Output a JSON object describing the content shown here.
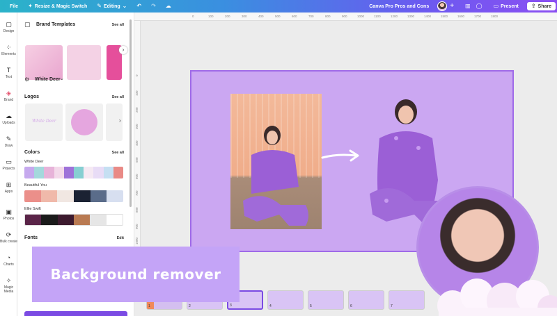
{
  "topbar": {
    "file": "File",
    "resize": "Resize & Magic Switch",
    "editing": "Editing",
    "doc_title": "Canva Pro Pros and Cons",
    "present": "Present",
    "share": "Share"
  },
  "rail": [
    {
      "label": "Design",
      "icon": "design-icon"
    },
    {
      "label": "Elements",
      "icon": "elements-icon"
    },
    {
      "label": "Text",
      "icon": "text-icon"
    },
    {
      "label": "Brand",
      "icon": "brand-icon"
    },
    {
      "label": "Uploads",
      "icon": "uploads-icon"
    },
    {
      "label": "Draw",
      "icon": "draw-icon"
    },
    {
      "label": "Projects",
      "icon": "projects-icon"
    },
    {
      "label": "Apps",
      "icon": "apps-icon"
    },
    {
      "label": "Photos",
      "icon": "photos-icon"
    },
    {
      "label": "Bulk create",
      "icon": "bulk-create-icon"
    },
    {
      "label": "Charts",
      "icon": "charts-icon"
    },
    {
      "label": "Magic Media",
      "icon": "magic-media-icon"
    }
  ],
  "panel": {
    "brand_templates": "Brand Templates",
    "see_all": "See all",
    "brand_kit": "White Deer",
    "logos": "Logos",
    "logo_text": "White Deer",
    "colors": "Colors",
    "palettes": [
      {
        "name": "White Deer",
        "colors": [
          "#c6a9ee",
          "#a4d8dc",
          "#e7b3d9",
          "#f3d9ea",
          "#9e72d9",
          "#86cfd2",
          "#f5e9f3",
          "#e8dcf6",
          "#c5dff2",
          "#e98a86"
        ]
      },
      {
        "name": "Beautiful You",
        "colors": [
          "#eb8f8a",
          "#f0b9aa",
          "#f1e7e2",
          "#1b2233",
          "#5a6c8a",
          "#d7dff0"
        ]
      },
      {
        "name": "Ellie Swift",
        "colors": [
          "#5a2448",
          "#1b1b1b",
          "#3c1a2e",
          "#b97a52",
          "#e6e6e6",
          "#ffffff"
        ]
      }
    ],
    "fonts": "Fonts",
    "edit": "Edit"
  },
  "ruler_top": [
    "0",
    "100",
    "200",
    "300",
    "400",
    "500",
    "600",
    "700",
    "800",
    "900",
    "1000",
    "1100",
    "1200",
    "1300",
    "1400",
    "1500",
    "1600",
    "1700",
    "1800"
  ],
  "ruler_left": [
    "0",
    "100",
    "200",
    "300",
    "400",
    "500",
    "600",
    "700",
    "800",
    "900",
    "1000"
  ],
  "pages": [
    "1",
    "2",
    "3",
    "4",
    "5",
    "6",
    "7"
  ],
  "caption": "Background remover"
}
